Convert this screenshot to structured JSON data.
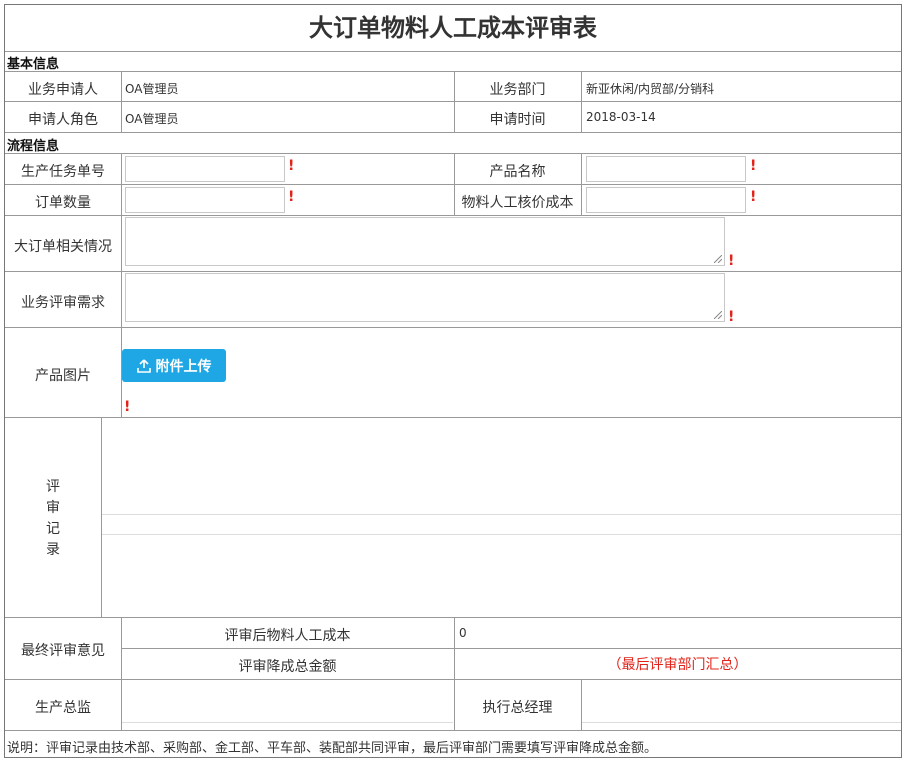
{
  "title": "大订单物料人工成本评审表",
  "basic_section": "基本信息",
  "basic": {
    "applicant_label": "业务申请人",
    "applicant_value": "OA管理员",
    "dept_label": "业务部门",
    "dept_value": "新亚休闲/内贸部/分销科",
    "role_label": "申请人角色",
    "role_value": "OA管理员",
    "time_label": "申请时间",
    "time_value": "2018-03-14"
  },
  "process_section": "流程信息",
  "process": {
    "task_no_label": "生产任务单号",
    "product_name_label": "产品名称",
    "order_qty_label": "订单数量",
    "cost_label": "物料人工核价成本",
    "order_info_label": "大订单相关情况",
    "review_need_label": "业务评审需求",
    "product_image_label": "产品图片",
    "upload_button": "附件上传",
    "required_mark": "!"
  },
  "review_record_label": "评审记录",
  "final": {
    "label": "最终评审意见",
    "after_cost_label": "评审后物料人工成本",
    "after_cost_value": "0",
    "reduce_label": "评审降成总金额",
    "reduce_note": "（最后评审部门汇总）"
  },
  "sign": {
    "prod_director": "生产总监",
    "exec_manager": "执行总经理"
  },
  "footer_note": "说明：评审记录由技术部、采购部、金工部、平车部、装配部共同评审，最后评审部门需要填写评审降成总金额。",
  "colors": {
    "accent": "#1ea7e4",
    "required": "#e2231a",
    "border": "#999999"
  }
}
